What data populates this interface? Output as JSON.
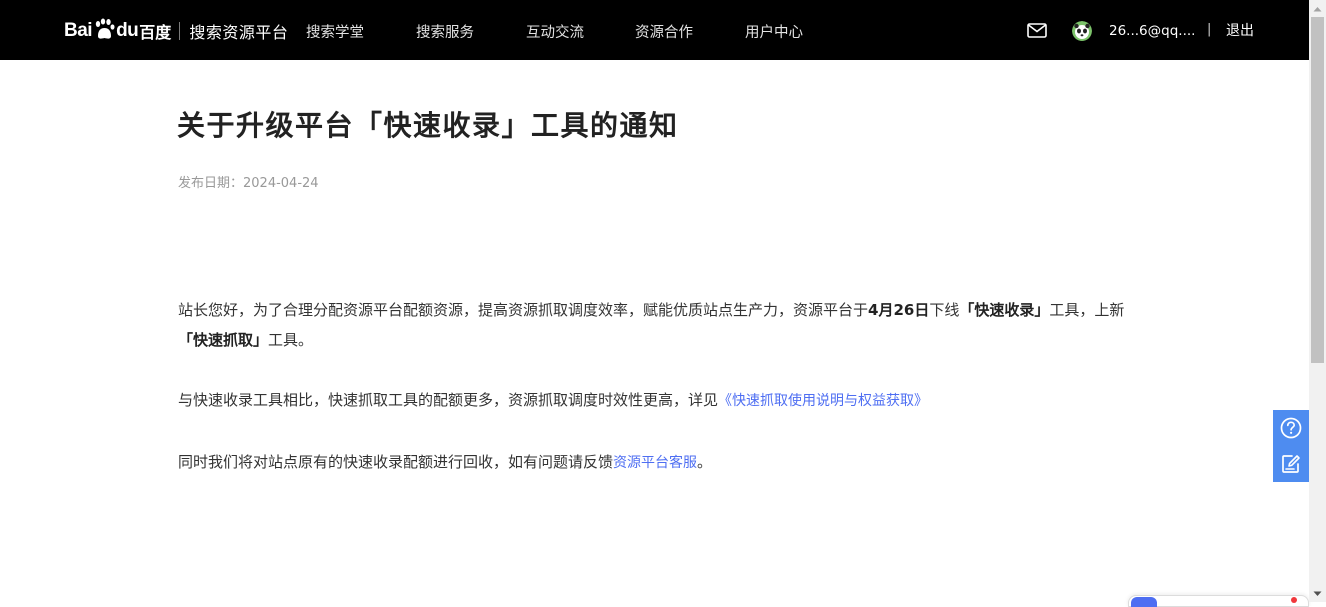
{
  "header": {
    "logo": {
      "bai": "Bai",
      "du": "du",
      "cn": "百度",
      "platform": "搜索资源平台"
    },
    "nav": [
      {
        "label": "搜索学堂"
      },
      {
        "label": "搜索服务"
      },
      {
        "label": "互动交流"
      },
      {
        "label": "资源合作"
      },
      {
        "label": "用户中心"
      }
    ],
    "mail_icon": "mail-icon",
    "avatar_icon": "panda-avatar",
    "user_name": "26...6@qq....",
    "separator": "|",
    "logout": "退出"
  },
  "article": {
    "title": "关于升级平台「快速收录」工具的通知",
    "publish_date": "发布日期：2024-04-24",
    "p1": {
      "t1": "站长您好，为了合理分配资源平台配额资源，提高资源抓取调度效率，赋能优质站点生产力，资源平台于",
      "b1": "4月26日",
      "t2": "下线",
      "b2": "「快速收录」",
      "t3": "工具，上新",
      "b3": "「快速抓取」",
      "t4": "工具。"
    },
    "p2": {
      "text": "与快速收录工具相比，快速抓取工具的配额更多，资源抓取调度时效性更高，详见",
      "link": "《快速抓取使用说明与权益获取》"
    },
    "p3": {
      "text": "同时我们将对站点原有的快速收录配额进行回收，如有问题请反馈",
      "link": "资源平台客服",
      "end": "。"
    }
  },
  "float_tools": {
    "help_icon": "help-question-icon",
    "feedback_icon": "feedback-edit-icon"
  },
  "colors": {
    "topbar_bg": "#000000",
    "link": "#4e6ef2",
    "tools_bg": "#4e8cf0"
  }
}
